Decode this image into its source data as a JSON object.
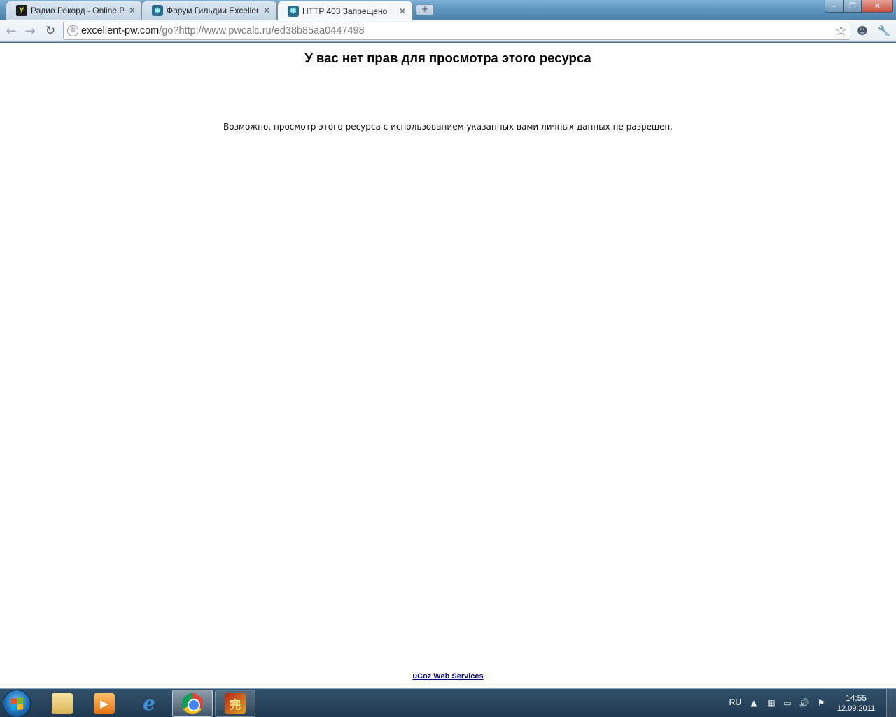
{
  "browser": {
    "tabs": [
      {
        "title": "Радио Рекорд - Online Pl...",
        "favicon": "radio-record-icon",
        "active": false
      },
      {
        "title": "Форум Гильдии Excellent",
        "favicon": "ucoz-icon",
        "active": false
      },
      {
        "title": "HTTP 403 Запрещено",
        "favicon": "ucoz-icon",
        "active": true
      }
    ],
    "new_tab_label": "+",
    "window_buttons": {
      "minimize": "–",
      "maximize": "❐",
      "close": "✕"
    },
    "address": {
      "domain": "excellent-pw.com",
      "path": "/go?http://www.pwcalc.ru/ed38b85aa0447498"
    }
  },
  "page": {
    "heading": "У вас нет прав для просмотра этого ресурса",
    "message": "Возможно, просмотр этого ресурса с использованием указанных вами личных данных не разрешен.",
    "footer_link": "uCoz Web Services"
  },
  "taskbar": {
    "items": [
      {
        "name": "windows-explorer",
        "icon": "folder-icon",
        "state": "pinned"
      },
      {
        "name": "windows-media-player",
        "icon": "media-player-icon",
        "state": "pinned"
      },
      {
        "name": "internet-explorer",
        "icon": "internet-explorer-icon",
        "state": "pinned"
      },
      {
        "name": "google-chrome",
        "icon": "chrome-icon",
        "state": "active"
      },
      {
        "name": "game-client",
        "icon": "game-icon",
        "state": "open"
      }
    ],
    "tray": {
      "language": "RU",
      "time": "14:55",
      "date": "12.09.2011"
    }
  },
  "colors": {
    "link": "#00008b",
    "page_background": "#ffffff",
    "taskbar": "#2c4b66"
  }
}
